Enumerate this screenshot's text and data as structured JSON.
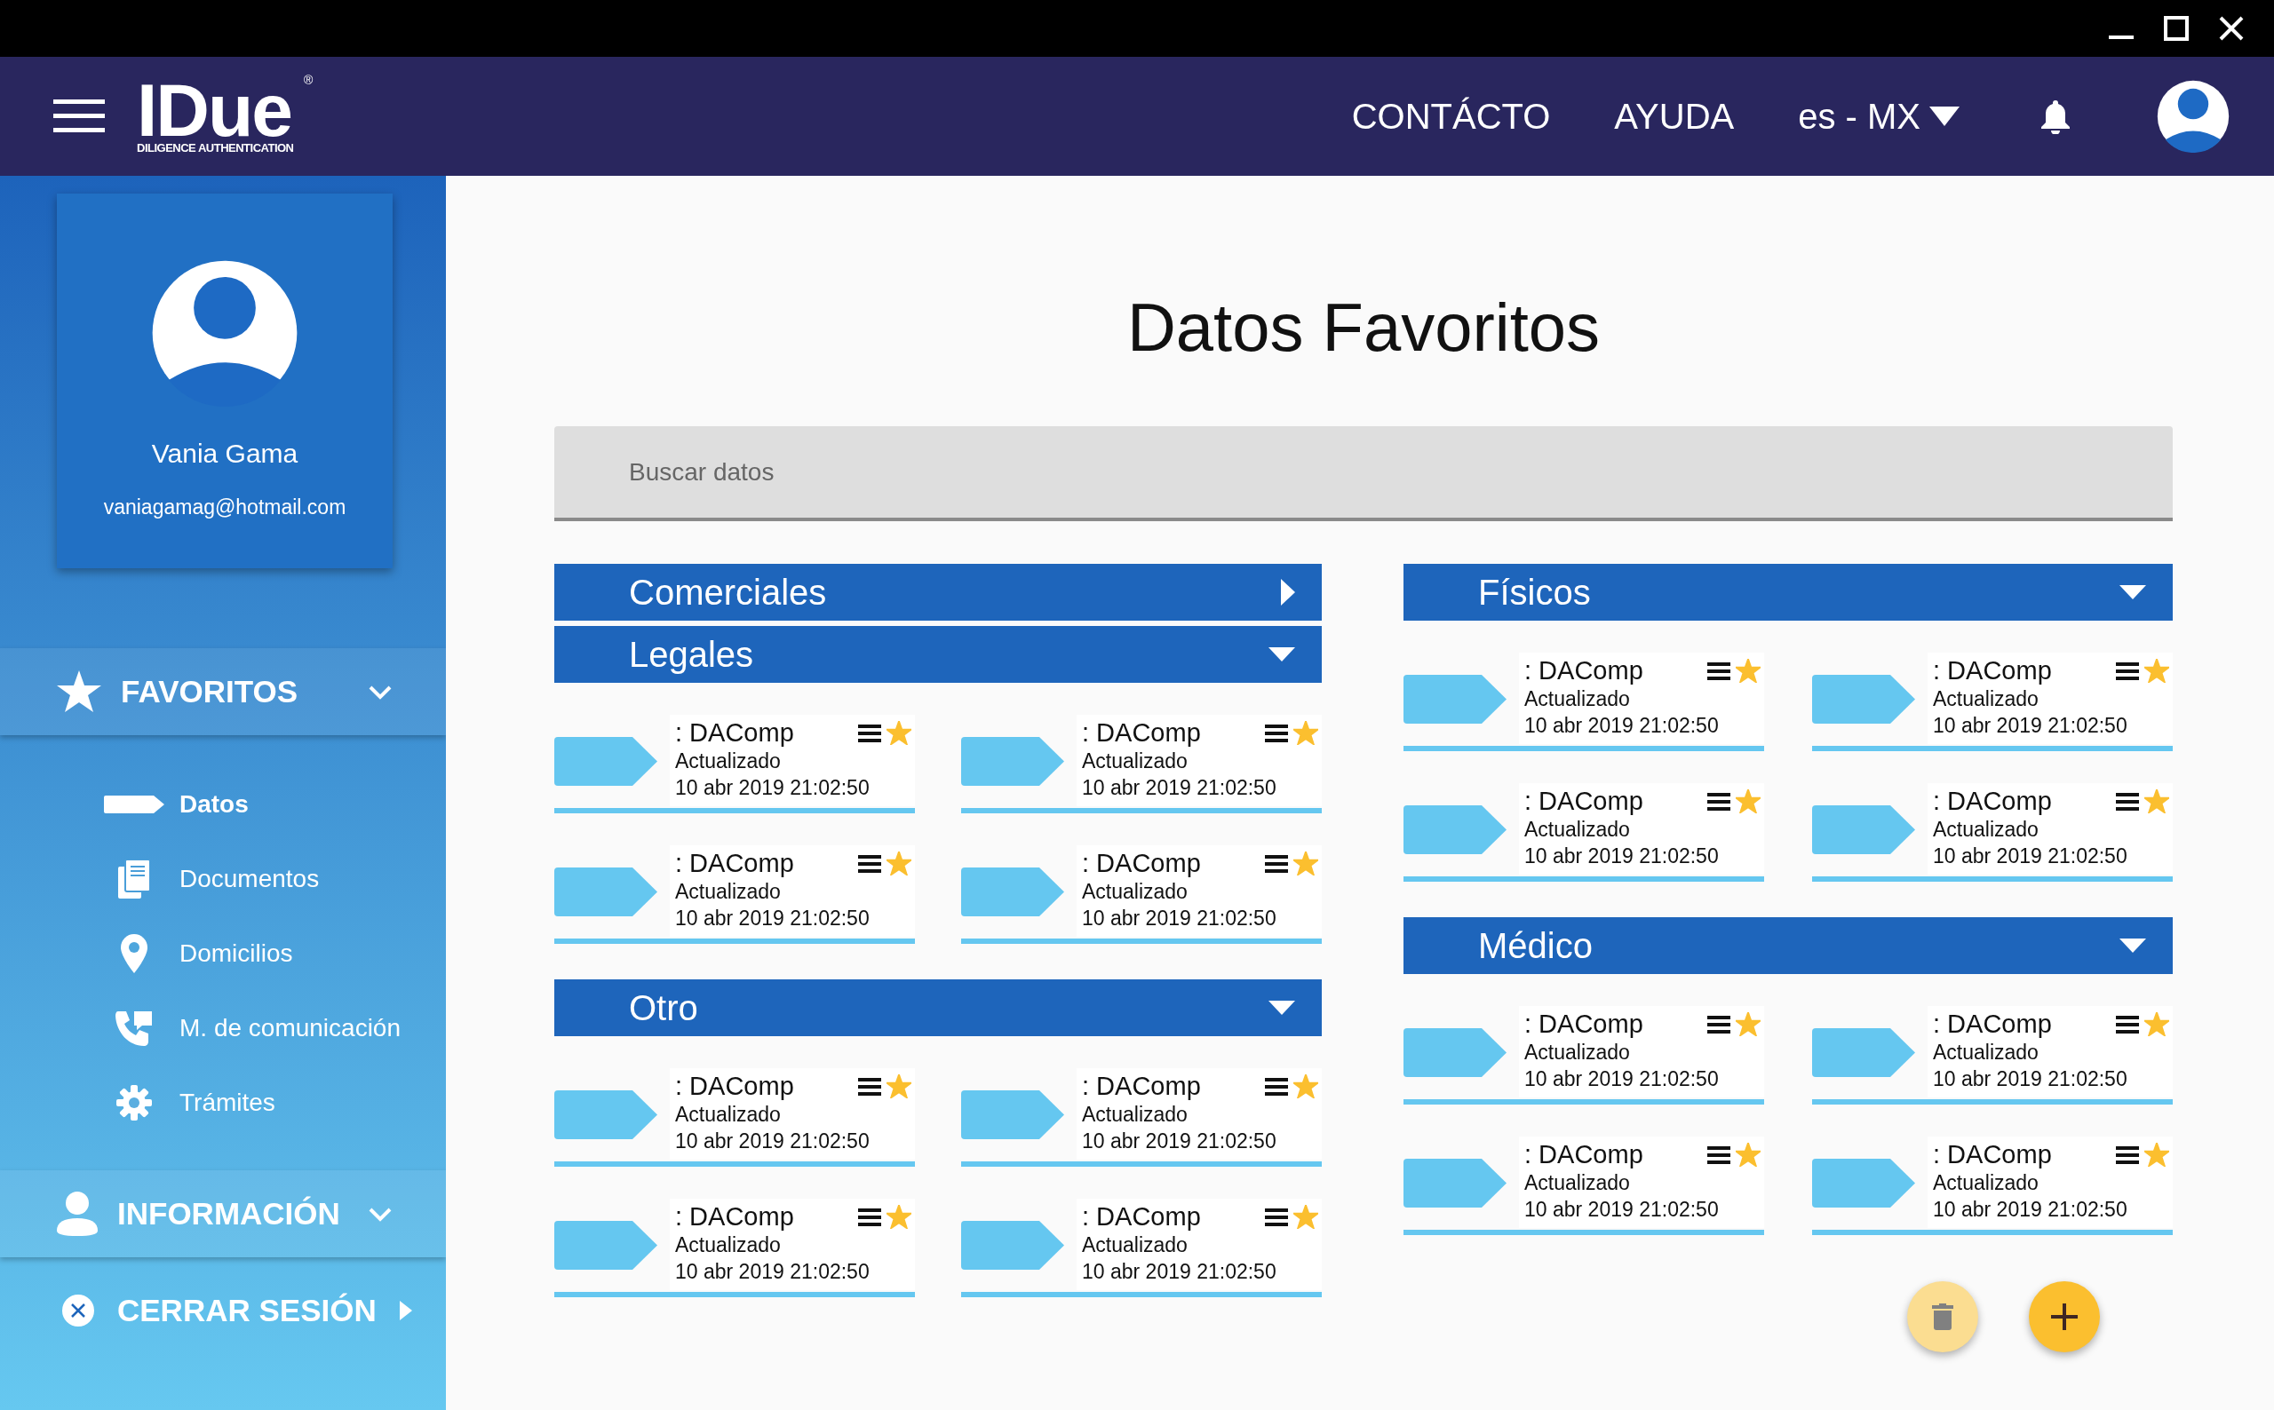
{
  "header": {
    "logo": {
      "wordmark": "IDue",
      "registered": "®",
      "tagline": "DILIGENCE AUTHENTICATION"
    },
    "nav": [
      "CONTÁCTO",
      "AYUDA"
    ],
    "language": "es - MX"
  },
  "sidebar": {
    "profile": {
      "name": "Vania Gama",
      "email": "vaniagamag@hotmail.com"
    },
    "sections": [
      {
        "label": "FAVORITOS",
        "items": [
          {
            "label": "Datos",
            "selected": true
          },
          {
            "label": "Documentos",
            "selected": false
          },
          {
            "label": "Domicilios",
            "selected": false
          },
          {
            "label": "M. de comunicación",
            "selected": false
          },
          {
            "label": "Trámites",
            "selected": false
          }
        ]
      },
      {
        "label": "INFORMACIÓN"
      }
    ],
    "logout": "CERRAR SESIÓN"
  },
  "main": {
    "title": "Datos Favoritos",
    "search": {
      "placeholder": "Buscar datos"
    },
    "columns": [
      [
        {
          "label": "Comerciales",
          "expanded": false
        },
        {
          "label": "Legales",
          "expanded": true,
          "cards": [
            {
              "title": ": DAComp",
              "status": "Actualizado",
              "date": "10 abr 2019 21:02:50",
              "favorite": true
            },
            {
              "title": ": DAComp",
              "status": "Actualizado",
              "date": "10 abr 2019 21:02:50",
              "favorite": true
            },
            {
              "title": ": DAComp",
              "status": "Actualizado",
              "date": "10 abr 2019 21:02:50",
              "favorite": true
            },
            {
              "title": ": DAComp",
              "status": "Actualizado",
              "date": "10 abr 2019 21:02:50",
              "favorite": true
            }
          ]
        },
        {
          "label": "Otro",
          "expanded": true,
          "cards": [
            {
              "title": ": DAComp",
              "status": "Actualizado",
              "date": "10 abr 2019 21:02:50",
              "favorite": true
            },
            {
              "title": ": DAComp",
              "status": "Actualizado",
              "date": "10 abr 2019 21:02:50",
              "favorite": true
            },
            {
              "title": ": DAComp",
              "status": "Actualizado",
              "date": "10 abr 2019 21:02:50",
              "favorite": true
            },
            {
              "title": ": DAComp",
              "status": "Actualizado",
              "date": "10 abr 2019 21:02:50",
              "favorite": true
            }
          ]
        }
      ],
      [
        {
          "label": "Físicos",
          "expanded": true,
          "cards": [
            {
              "title": ": DAComp",
              "status": "Actualizado",
              "date": "10 abr 2019 21:02:50",
              "favorite": true
            },
            {
              "title": ": DAComp",
              "status": "Actualizado",
              "date": "10 abr 2019 21:02:50",
              "favorite": true
            },
            {
              "title": ": DAComp",
              "status": "Actualizado",
              "date": "10 abr 2019 21:02:50",
              "favorite": true
            },
            {
              "title": ": DAComp",
              "status": "Actualizado",
              "date": "10 abr 2019 21:02:50",
              "favorite": true
            }
          ]
        },
        {
          "label": "Médico",
          "expanded": true,
          "cards": [
            {
              "title": ": DAComp",
              "status": "Actualizado",
              "date": "10 abr 2019 21:02:50",
              "favorite": true
            },
            {
              "title": ": DAComp",
              "status": "Actualizado",
              "date": "10 abr 2019 21:02:50",
              "favorite": true
            },
            {
              "title": ": DAComp",
              "status": "Actualizado",
              "date": "10 abr 2019 21:02:50",
              "favorite": true
            },
            {
              "title": ": DAComp",
              "status": "Actualizado",
              "date": "10 abr 2019 21:02:50",
              "favorite": true
            }
          ]
        }
      ]
    ],
    "actions": [
      {
        "kind": "delete",
        "disabled": true
      },
      {
        "kind": "add",
        "disabled": false
      }
    ]
  }
}
